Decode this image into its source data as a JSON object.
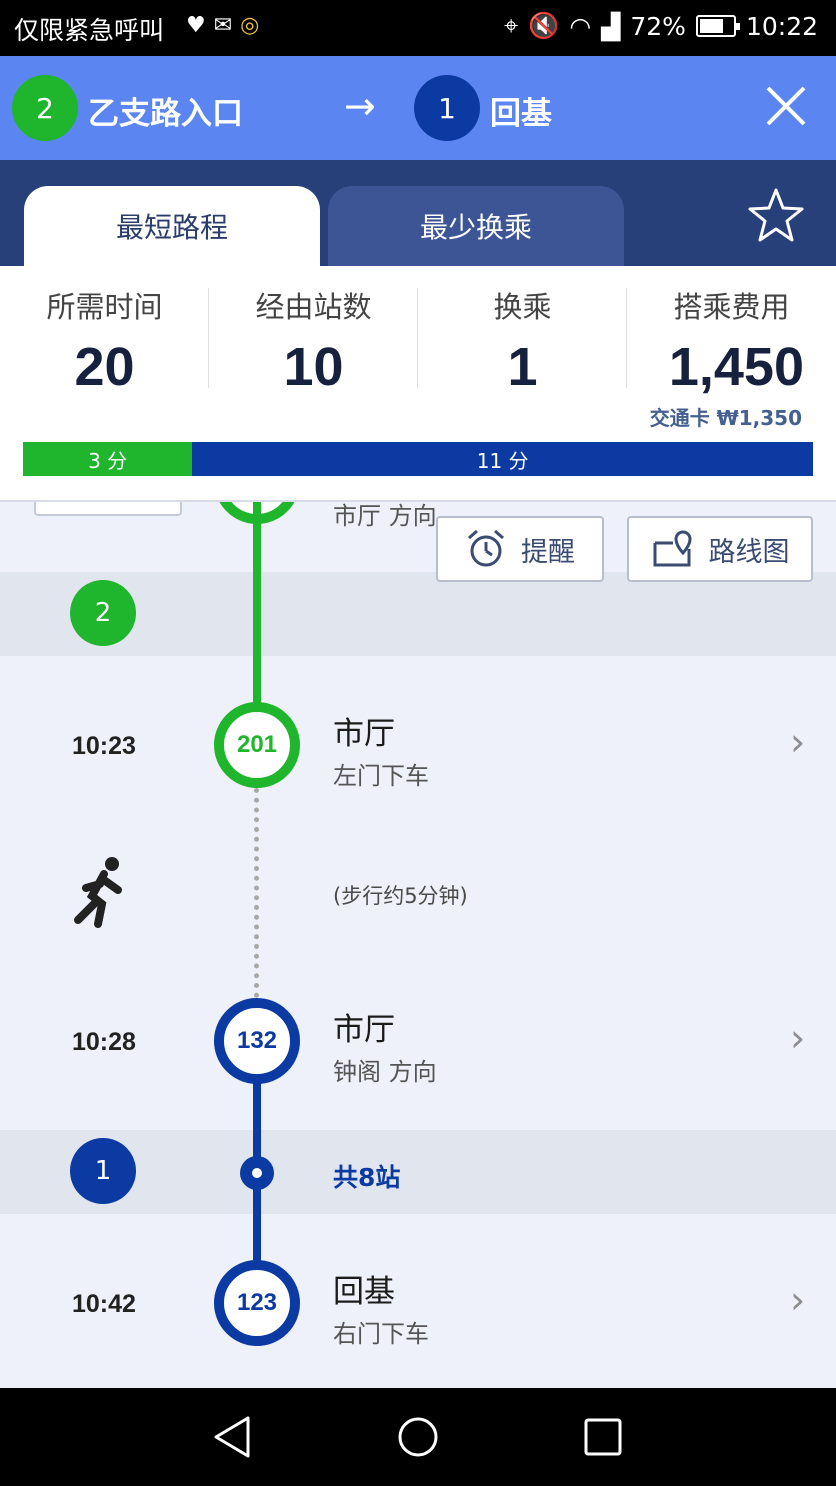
{
  "status_bar": {
    "emergency_text": "仅限紧急呼叫",
    "battery": "72%",
    "battery_level": 0.72,
    "time": "10:22"
  },
  "route": {
    "from_line": "2",
    "from_station": "乙支路入口",
    "to_line": "1",
    "to_station": "回基",
    "arrow": "→"
  },
  "tabs": [
    {
      "label": "最短路程",
      "active": true
    },
    {
      "label": "最少换乘",
      "active": false
    }
  ],
  "summary": {
    "columns": [
      {
        "label": "所需时间",
        "value": "20"
      },
      {
        "label": "经由站数",
        "value": "10"
      },
      {
        "label": "换乘",
        "value": "1"
      },
      {
        "label": "搭乘费用",
        "value": "1,450"
      }
    ],
    "card_fare": "交通卡 ₩1,350",
    "time_bar": [
      {
        "label": "3 分",
        "minutes": 3,
        "color": "#1fb52c"
      },
      {
        "label": "11 分",
        "minutes": 11,
        "color": "#0b3aa3"
      }
    ]
  },
  "actions": {
    "remind_label": "提醒",
    "map_label": "路线图"
  },
  "timeline": {
    "partial_top_text": "市厅 方向",
    "line2_badge": "2",
    "line1_badge": "1",
    "stops": [
      {
        "time": "10:23",
        "code": "201",
        "name": "市厅",
        "sub": "左门下车"
      },
      {
        "time": "10:28",
        "code": "132",
        "name": "市厅",
        "sub": "钟阁 方向"
      },
      {
        "time": "10:42",
        "code": "123",
        "name": "回基",
        "sub": "右门下车"
      }
    ],
    "walk_text": "(步行约5分钟)",
    "stations_count": "共8站"
  },
  "colors": {
    "line2": "#1fb52c",
    "line1": "#0b3aa3",
    "header": "#5b86f2",
    "tabs_bg": "#28407a"
  }
}
